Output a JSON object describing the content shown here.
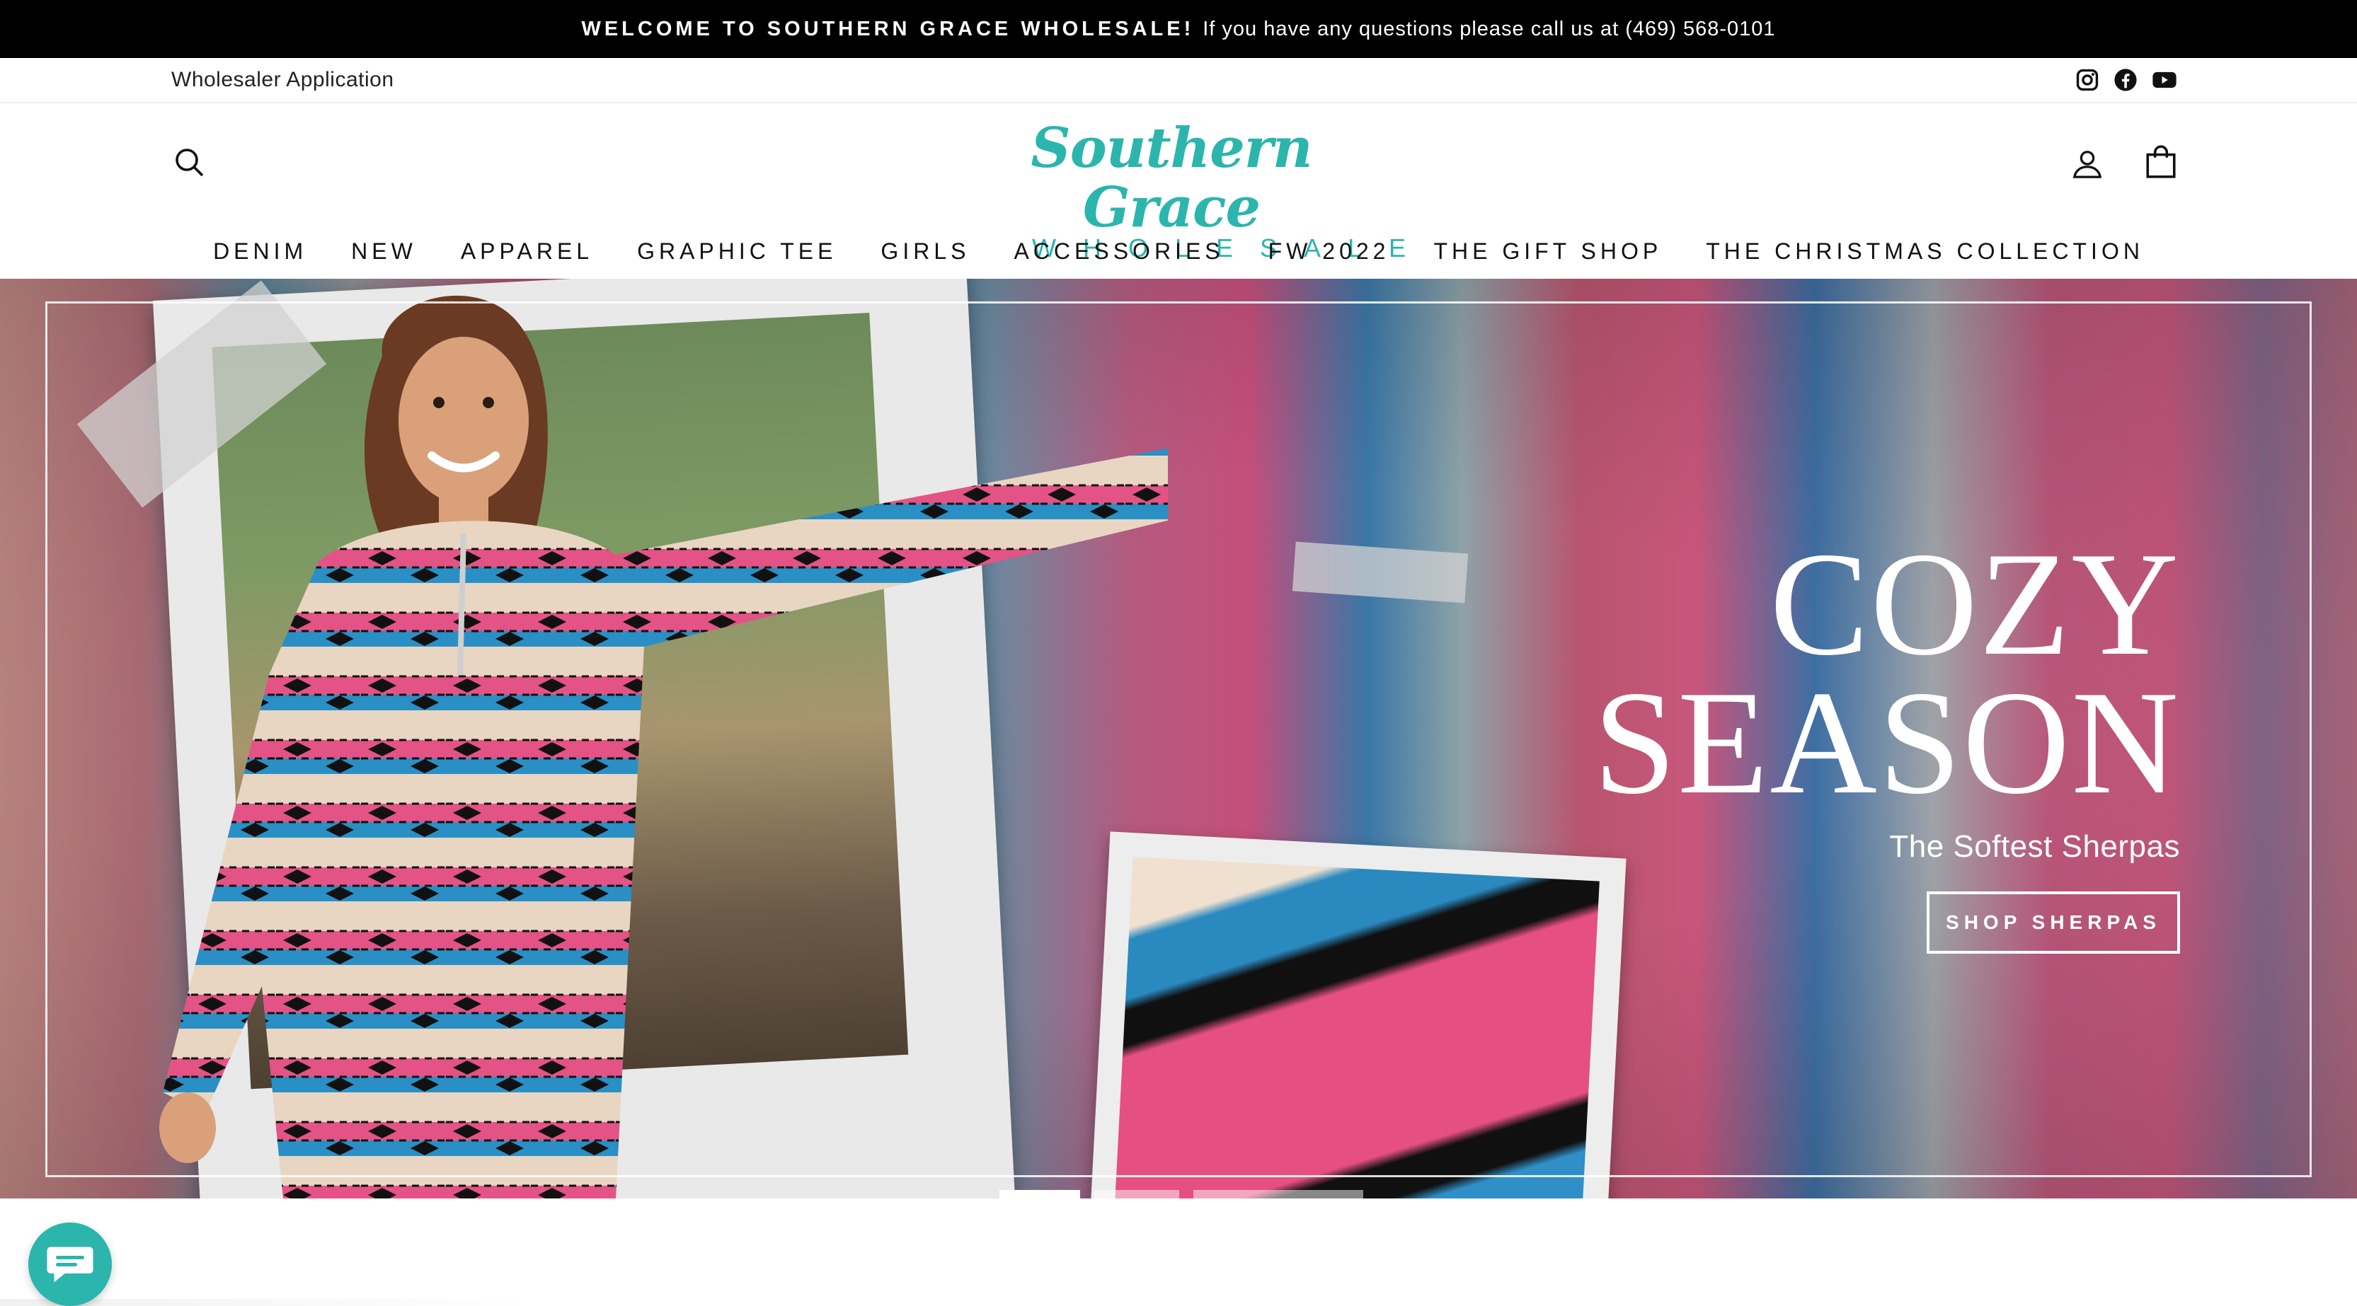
{
  "announcement": {
    "bold": "WELCOME TO SOUTHERN GRACE WHOLESALE!",
    "text": "If you have any questions please call us at (469) 568-0101"
  },
  "utility": {
    "wholesaler_link": "Wholesaler Application",
    "social_icons": [
      "instagram-icon",
      "facebook-icon",
      "youtube-icon"
    ]
  },
  "header": {
    "logo_script": "Southern Grace",
    "logo_sub": "WHOLESALE",
    "icons": [
      "search-icon",
      "account-icon",
      "cart-icon"
    ]
  },
  "nav": {
    "items": [
      "DENIM",
      "NEW",
      "APPAREL",
      "GRAPHIC TEE",
      "GIRLS",
      "ACCESSORIES",
      "FW 2022",
      "THE GIFT SHOP",
      "THE CHRISTMAS COLLECTION"
    ]
  },
  "hero": {
    "title_line1": "COZY",
    "title_line2": "SEASON",
    "subtitle": "The Softest Sherpas",
    "button": "SHOP SHERPAS"
  },
  "slider": {
    "slides": 3,
    "active_index": 0
  },
  "colors": {
    "brand": "#2bb5ad",
    "announcement_bg": "#000000"
  }
}
